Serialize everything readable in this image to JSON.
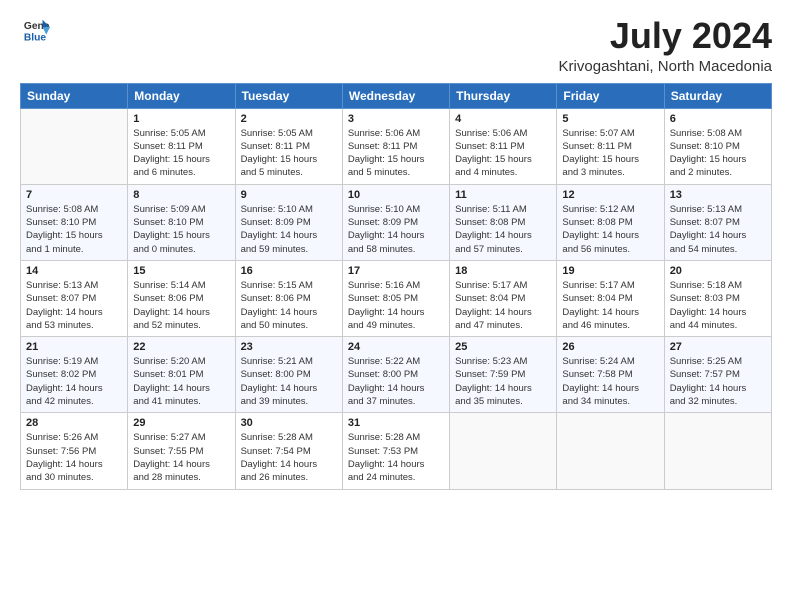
{
  "logo": {
    "general": "General",
    "blue": "Blue"
  },
  "header": {
    "title": "July 2024",
    "subtitle": "Krivogashtani, North Macedonia"
  },
  "weekdays": [
    "Sunday",
    "Monday",
    "Tuesday",
    "Wednesday",
    "Thursday",
    "Friday",
    "Saturday"
  ],
  "weeks": [
    [
      {
        "day": "",
        "info": ""
      },
      {
        "day": "1",
        "info": "Sunrise: 5:05 AM\nSunset: 8:11 PM\nDaylight: 15 hours\nand 6 minutes."
      },
      {
        "day": "2",
        "info": "Sunrise: 5:05 AM\nSunset: 8:11 PM\nDaylight: 15 hours\nand 5 minutes."
      },
      {
        "day": "3",
        "info": "Sunrise: 5:06 AM\nSunset: 8:11 PM\nDaylight: 15 hours\nand 5 minutes."
      },
      {
        "day": "4",
        "info": "Sunrise: 5:06 AM\nSunset: 8:11 PM\nDaylight: 15 hours\nand 4 minutes."
      },
      {
        "day": "5",
        "info": "Sunrise: 5:07 AM\nSunset: 8:11 PM\nDaylight: 15 hours\nand 3 minutes."
      },
      {
        "day": "6",
        "info": "Sunrise: 5:08 AM\nSunset: 8:10 PM\nDaylight: 15 hours\nand 2 minutes."
      }
    ],
    [
      {
        "day": "7",
        "info": "Sunrise: 5:08 AM\nSunset: 8:10 PM\nDaylight: 15 hours\nand 1 minute."
      },
      {
        "day": "8",
        "info": "Sunrise: 5:09 AM\nSunset: 8:10 PM\nDaylight: 15 hours\nand 0 minutes."
      },
      {
        "day": "9",
        "info": "Sunrise: 5:10 AM\nSunset: 8:09 PM\nDaylight: 14 hours\nand 59 minutes."
      },
      {
        "day": "10",
        "info": "Sunrise: 5:10 AM\nSunset: 8:09 PM\nDaylight: 14 hours\nand 58 minutes."
      },
      {
        "day": "11",
        "info": "Sunrise: 5:11 AM\nSunset: 8:08 PM\nDaylight: 14 hours\nand 57 minutes."
      },
      {
        "day": "12",
        "info": "Sunrise: 5:12 AM\nSunset: 8:08 PM\nDaylight: 14 hours\nand 56 minutes."
      },
      {
        "day": "13",
        "info": "Sunrise: 5:13 AM\nSunset: 8:07 PM\nDaylight: 14 hours\nand 54 minutes."
      }
    ],
    [
      {
        "day": "14",
        "info": "Sunrise: 5:13 AM\nSunset: 8:07 PM\nDaylight: 14 hours\nand 53 minutes."
      },
      {
        "day": "15",
        "info": "Sunrise: 5:14 AM\nSunset: 8:06 PM\nDaylight: 14 hours\nand 52 minutes."
      },
      {
        "day": "16",
        "info": "Sunrise: 5:15 AM\nSunset: 8:06 PM\nDaylight: 14 hours\nand 50 minutes."
      },
      {
        "day": "17",
        "info": "Sunrise: 5:16 AM\nSunset: 8:05 PM\nDaylight: 14 hours\nand 49 minutes."
      },
      {
        "day": "18",
        "info": "Sunrise: 5:17 AM\nSunset: 8:04 PM\nDaylight: 14 hours\nand 47 minutes."
      },
      {
        "day": "19",
        "info": "Sunrise: 5:17 AM\nSunset: 8:04 PM\nDaylight: 14 hours\nand 46 minutes."
      },
      {
        "day": "20",
        "info": "Sunrise: 5:18 AM\nSunset: 8:03 PM\nDaylight: 14 hours\nand 44 minutes."
      }
    ],
    [
      {
        "day": "21",
        "info": "Sunrise: 5:19 AM\nSunset: 8:02 PM\nDaylight: 14 hours\nand 42 minutes."
      },
      {
        "day": "22",
        "info": "Sunrise: 5:20 AM\nSunset: 8:01 PM\nDaylight: 14 hours\nand 41 minutes."
      },
      {
        "day": "23",
        "info": "Sunrise: 5:21 AM\nSunset: 8:00 PM\nDaylight: 14 hours\nand 39 minutes."
      },
      {
        "day": "24",
        "info": "Sunrise: 5:22 AM\nSunset: 8:00 PM\nDaylight: 14 hours\nand 37 minutes."
      },
      {
        "day": "25",
        "info": "Sunrise: 5:23 AM\nSunset: 7:59 PM\nDaylight: 14 hours\nand 35 minutes."
      },
      {
        "day": "26",
        "info": "Sunrise: 5:24 AM\nSunset: 7:58 PM\nDaylight: 14 hours\nand 34 minutes."
      },
      {
        "day": "27",
        "info": "Sunrise: 5:25 AM\nSunset: 7:57 PM\nDaylight: 14 hours\nand 32 minutes."
      }
    ],
    [
      {
        "day": "28",
        "info": "Sunrise: 5:26 AM\nSunset: 7:56 PM\nDaylight: 14 hours\nand 30 minutes."
      },
      {
        "day": "29",
        "info": "Sunrise: 5:27 AM\nSunset: 7:55 PM\nDaylight: 14 hours\nand 28 minutes."
      },
      {
        "day": "30",
        "info": "Sunrise: 5:28 AM\nSunset: 7:54 PM\nDaylight: 14 hours\nand 26 minutes."
      },
      {
        "day": "31",
        "info": "Sunrise: 5:28 AM\nSunset: 7:53 PM\nDaylight: 14 hours\nand 24 minutes."
      },
      {
        "day": "",
        "info": ""
      },
      {
        "day": "",
        "info": ""
      },
      {
        "day": "",
        "info": ""
      }
    ]
  ]
}
